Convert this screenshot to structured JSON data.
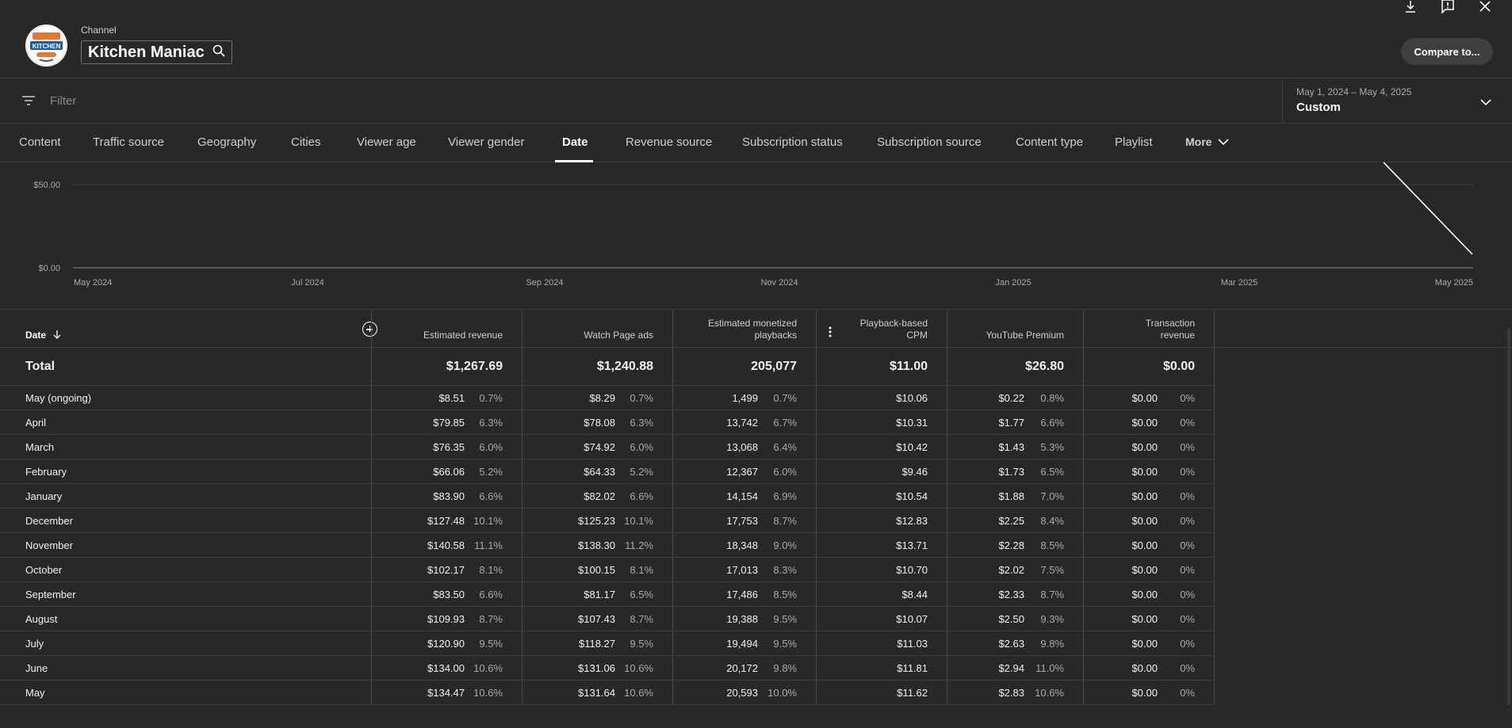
{
  "header": {
    "channel_label": "Channel",
    "channel_name": "Kitchen Maniac",
    "logo_text": "KITCHEN",
    "compare_label": "Compare to..."
  },
  "filter": {
    "placeholder": "Filter"
  },
  "date_range": {
    "range": "May 1, 2024 – May 4, 2025",
    "preset": "Custom"
  },
  "tabs": [
    {
      "label": "Content"
    },
    {
      "label": "Traffic source"
    },
    {
      "label": "Geography"
    },
    {
      "label": "Cities"
    },
    {
      "label": "Viewer age"
    },
    {
      "label": "Viewer gender"
    },
    {
      "label": "Date",
      "active": true
    },
    {
      "label": "Revenue source"
    },
    {
      "label": "Subscription status"
    },
    {
      "label": "Subscription source"
    },
    {
      "label": "Content type"
    },
    {
      "label": "Playlist"
    },
    {
      "label": "More"
    }
  ],
  "chart_data": {
    "type": "line",
    "y_ticks": [
      "$50.00",
      "$0.00"
    ],
    "x_ticks": [
      "May 2024",
      "Jul 2024",
      "Sep 2024",
      "Nov 2024",
      "Jan 2025",
      "Mar 2025",
      "May 2025"
    ],
    "grid": true,
    "visible_segment": {
      "x": [
        "2025-04",
        "2025-05"
      ],
      "y_note": "line descends from above visible area to near $0.00"
    }
  },
  "table": {
    "columns": {
      "date": "Date",
      "estimated_revenue": "Estimated revenue",
      "watch_page_ads": "Watch Page ads",
      "monetized_playbacks_1": "Estimated monetized",
      "monetized_playbacks_2": "playbacks",
      "cpm_1": "Playback-based",
      "cpm_2": "CPM",
      "premium": "YouTube Premium",
      "transaction_1": "Transaction",
      "transaction_2": "revenue"
    },
    "total": {
      "label": "Total",
      "revenue": "$1,267.69",
      "watch": "$1,240.88",
      "playbacks": "205,077",
      "cpm": "$11.00",
      "premium": "$26.80",
      "transaction": "$0.00"
    },
    "rows": [
      {
        "date": "May (ongoing)",
        "revenue": "$8.51",
        "revenue_pct": "0.7%",
        "watch": "$8.29",
        "watch_pct": "0.7%",
        "playbacks": "1,499",
        "playbacks_pct": "0.7%",
        "cpm": "$10.06",
        "premium": "$0.22",
        "premium_pct": "0.8%",
        "transaction": "$0.00",
        "transaction_pct": "0%"
      },
      {
        "date": "April",
        "revenue": "$79.85",
        "revenue_pct": "6.3%",
        "watch": "$78.08",
        "watch_pct": "6.3%",
        "playbacks": "13,742",
        "playbacks_pct": "6.7%",
        "cpm": "$10.31",
        "premium": "$1.77",
        "premium_pct": "6.6%",
        "transaction": "$0.00",
        "transaction_pct": "0%"
      },
      {
        "date": "March",
        "revenue": "$76.35",
        "revenue_pct": "6.0%",
        "watch": "$74.92",
        "watch_pct": "6.0%",
        "playbacks": "13,068",
        "playbacks_pct": "6.4%",
        "cpm": "$10.42",
        "premium": "$1.43",
        "premium_pct": "5.3%",
        "transaction": "$0.00",
        "transaction_pct": "0%"
      },
      {
        "date": "February",
        "revenue": "$66.06",
        "revenue_pct": "5.2%",
        "watch": "$64.33",
        "watch_pct": "5.2%",
        "playbacks": "12,367",
        "playbacks_pct": "6.0%",
        "cpm": "$9.46",
        "premium": "$1.73",
        "premium_pct": "6.5%",
        "transaction": "$0.00",
        "transaction_pct": "0%"
      },
      {
        "date": "January",
        "revenue": "$83.90",
        "revenue_pct": "6.6%",
        "watch": "$82.02",
        "watch_pct": "6.6%",
        "playbacks": "14,154",
        "playbacks_pct": "6.9%",
        "cpm": "$10.54",
        "premium": "$1.88",
        "premium_pct": "7.0%",
        "transaction": "$0.00",
        "transaction_pct": "0%"
      },
      {
        "date": "December",
        "revenue": "$127.48",
        "revenue_pct": "10.1%",
        "watch": "$125.23",
        "watch_pct": "10.1%",
        "playbacks": "17,753",
        "playbacks_pct": "8.7%",
        "cpm": "$12.83",
        "premium": "$2.25",
        "premium_pct": "8.4%",
        "transaction": "$0.00",
        "transaction_pct": "0%"
      },
      {
        "date": "November",
        "revenue": "$140.58",
        "revenue_pct": "11.1%",
        "watch": "$138.30",
        "watch_pct": "11.2%",
        "playbacks": "18,348",
        "playbacks_pct": "9.0%",
        "cpm": "$13.71",
        "premium": "$2.28",
        "premium_pct": "8.5%",
        "transaction": "$0.00",
        "transaction_pct": "0%"
      },
      {
        "date": "October",
        "revenue": "$102.17",
        "revenue_pct": "8.1%",
        "watch": "$100.15",
        "watch_pct": "8.1%",
        "playbacks": "17,013",
        "playbacks_pct": "8.3%",
        "cpm": "$10.70",
        "premium": "$2.02",
        "premium_pct": "7.5%",
        "transaction": "$0.00",
        "transaction_pct": "0%"
      },
      {
        "date": "September",
        "revenue": "$83.50",
        "revenue_pct": "6.6%",
        "watch": "$81.17",
        "watch_pct": "6.5%",
        "playbacks": "17,486",
        "playbacks_pct": "8.5%",
        "cpm": "$8.44",
        "premium": "$2.33",
        "premium_pct": "8.7%",
        "transaction": "$0.00",
        "transaction_pct": "0%"
      },
      {
        "date": "August",
        "revenue": "$109.93",
        "revenue_pct": "8.7%",
        "watch": "$107.43",
        "watch_pct": "8.7%",
        "playbacks": "19,388",
        "playbacks_pct": "9.5%",
        "cpm": "$10.07",
        "premium": "$2.50",
        "premium_pct": "9.3%",
        "transaction": "$0.00",
        "transaction_pct": "0%"
      },
      {
        "date": "July",
        "revenue": "$120.90",
        "revenue_pct": "9.5%",
        "watch": "$118.27",
        "watch_pct": "9.5%",
        "playbacks": "19,494",
        "playbacks_pct": "9.5%",
        "cpm": "$11.03",
        "premium": "$2.63",
        "premium_pct": "9.8%",
        "transaction": "$0.00",
        "transaction_pct": "0%"
      },
      {
        "date": "June",
        "revenue": "$134.00",
        "revenue_pct": "10.6%",
        "watch": "$131.06",
        "watch_pct": "10.6%",
        "playbacks": "20,172",
        "playbacks_pct": "9.8%",
        "cpm": "$11.81",
        "premium": "$2.94",
        "premium_pct": "11.0%",
        "transaction": "$0.00",
        "transaction_pct": "0%"
      },
      {
        "date": "May",
        "revenue": "$134.47",
        "revenue_pct": "10.6%",
        "watch": "$131.64",
        "watch_pct": "10.6%",
        "playbacks": "20,593",
        "playbacks_pct": "10.0%",
        "cpm": "$11.62",
        "premium": "$2.83",
        "premium_pct": "10.6%",
        "transaction": "$0.00",
        "transaction_pct": "0%"
      }
    ]
  }
}
